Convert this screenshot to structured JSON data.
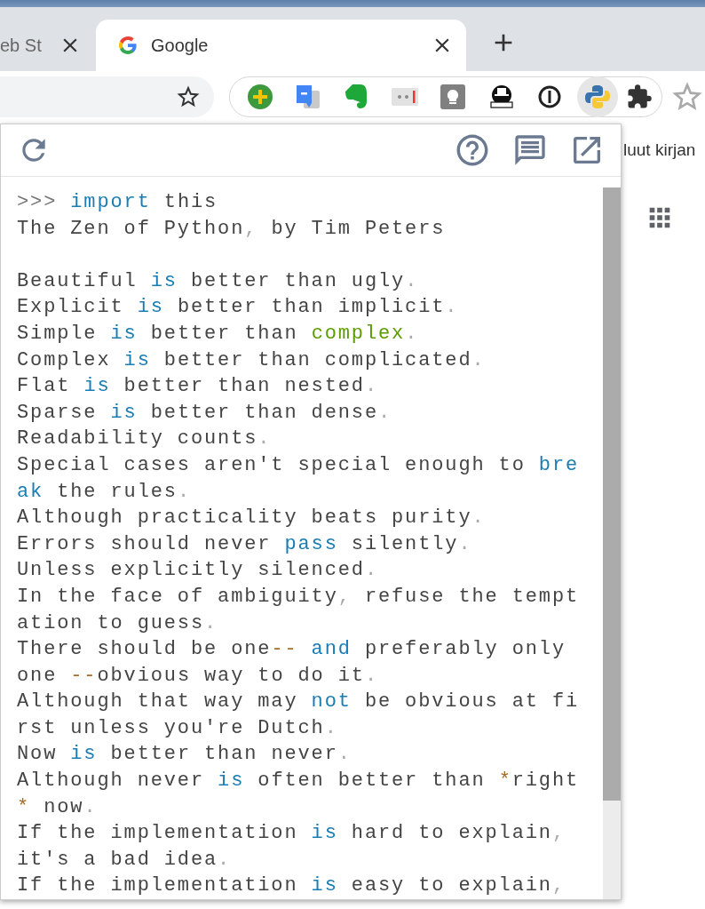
{
  "tabs": [
    {
      "title": "eb St",
      "selected": false
    },
    {
      "title": "Google",
      "selected": true
    }
  ],
  "page": {
    "bookmark_text": "luut kirjan"
  },
  "console": {
    "lines": [
      {
        "kind": "code",
        "segments": [
          {
            "text": ">>> ",
            "kind": "prompt"
          },
          {
            "text": "import",
            "kind": "keyword"
          },
          {
            "text": " this",
            "kind": "text"
          }
        ]
      },
      {
        "kind": "code",
        "segments": [
          {
            "text": "The Zen of Python",
            "kind": "text"
          },
          {
            "text": ",",
            "kind": "punct"
          },
          {
            "text": " by Tim Peters",
            "kind": "text"
          }
        ]
      },
      {
        "kind": "spacer"
      },
      {
        "kind": "code",
        "segments": [
          {
            "text": "Beautiful ",
            "kind": "text"
          },
          {
            "text": "is",
            "kind": "keyword"
          },
          {
            "text": " better than ugly",
            "kind": "text"
          },
          {
            "text": ".",
            "kind": "punct"
          }
        ]
      },
      {
        "kind": "code",
        "segments": [
          {
            "text": "Explicit ",
            "kind": "text"
          },
          {
            "text": "is",
            "kind": "keyword"
          },
          {
            "text": " better than implicit",
            "kind": "text"
          },
          {
            "text": ".",
            "kind": "punct"
          }
        ]
      },
      {
        "kind": "code",
        "segments": [
          {
            "text": "Simple ",
            "kind": "text"
          },
          {
            "text": "is",
            "kind": "keyword"
          },
          {
            "text": " better than ",
            "kind": "text"
          },
          {
            "text": "complex",
            "kind": "builtin"
          },
          {
            "text": ".",
            "kind": "punct"
          }
        ]
      },
      {
        "kind": "code",
        "segments": [
          {
            "text": "Complex ",
            "kind": "text"
          },
          {
            "text": "is",
            "kind": "keyword"
          },
          {
            "text": " better than complicated",
            "kind": "text"
          },
          {
            "text": ".",
            "kind": "punct"
          }
        ]
      },
      {
        "kind": "code",
        "segments": [
          {
            "text": "Flat ",
            "kind": "text"
          },
          {
            "text": "is",
            "kind": "keyword"
          },
          {
            "text": " better than nested",
            "kind": "text"
          },
          {
            "text": ".",
            "kind": "punct"
          }
        ]
      },
      {
        "kind": "code",
        "segments": [
          {
            "text": "Sparse ",
            "kind": "text"
          },
          {
            "text": "is",
            "kind": "keyword"
          },
          {
            "text": " better than dense",
            "kind": "text"
          },
          {
            "text": ".",
            "kind": "punct"
          }
        ]
      },
      {
        "kind": "code",
        "segments": [
          {
            "text": "Readability counts",
            "kind": "text"
          },
          {
            "text": ".",
            "kind": "punct"
          }
        ]
      },
      {
        "kind": "code",
        "segments": [
          {
            "text": "Special cases aren't special enough to ",
            "kind": "text"
          },
          {
            "text": "bre",
            "kind": "keyword"
          }
        ]
      },
      {
        "kind": "code",
        "segments": [
          {
            "text": "ak",
            "kind": "keyword"
          },
          {
            "text": " the rules",
            "kind": "text"
          },
          {
            "text": ".",
            "kind": "punct"
          }
        ]
      },
      {
        "kind": "code",
        "segments": [
          {
            "text": "Although practicality beats purity",
            "kind": "text"
          },
          {
            "text": ".",
            "kind": "punct"
          }
        ]
      },
      {
        "kind": "code",
        "segments": [
          {
            "text": "Errors should never ",
            "kind": "text"
          },
          {
            "text": "pass",
            "kind": "keyword"
          },
          {
            "text": " silently",
            "kind": "text"
          },
          {
            "text": ".",
            "kind": "punct"
          }
        ]
      },
      {
        "kind": "code",
        "segments": [
          {
            "text": "Unless explicitly silenced",
            "kind": "text"
          },
          {
            "text": ".",
            "kind": "punct"
          }
        ]
      },
      {
        "kind": "code",
        "segments": [
          {
            "text": "In the face of ambiguity",
            "kind": "text"
          },
          {
            "text": ",",
            "kind": "punct"
          },
          {
            "text": " refuse the tempt",
            "kind": "text"
          }
        ]
      },
      {
        "kind": "code",
        "segments": [
          {
            "text": "ation to guess",
            "kind": "text"
          },
          {
            "text": ".",
            "kind": "punct"
          }
        ]
      },
      {
        "kind": "code",
        "segments": [
          {
            "text": "There should be one",
            "kind": "text"
          },
          {
            "text": "-- ",
            "kind": "operator"
          },
          {
            "text": "and",
            "kind": "keyword"
          },
          {
            "text": " preferably only",
            "kind": "text"
          }
        ]
      },
      {
        "kind": "code",
        "segments": [
          {
            "text": "one ",
            "kind": "text"
          },
          {
            "text": "--",
            "kind": "operator"
          },
          {
            "text": "obvious way to do it",
            "kind": "text"
          },
          {
            "text": ".",
            "kind": "punct"
          }
        ]
      },
      {
        "kind": "code",
        "segments": [
          {
            "text": "Although that way may ",
            "kind": "text"
          },
          {
            "text": "not",
            "kind": "keyword"
          },
          {
            "text": " be obvious at fi",
            "kind": "text"
          }
        ]
      },
      {
        "kind": "code",
        "segments": [
          {
            "text": "rst unless you're Dutch",
            "kind": "text"
          },
          {
            "text": ".",
            "kind": "punct"
          }
        ]
      },
      {
        "kind": "code",
        "segments": [
          {
            "text": "Now ",
            "kind": "text"
          },
          {
            "text": "is",
            "kind": "keyword"
          },
          {
            "text": " better than never",
            "kind": "text"
          },
          {
            "text": ".",
            "kind": "punct"
          }
        ]
      },
      {
        "kind": "code",
        "segments": [
          {
            "text": "Although never ",
            "kind": "text"
          },
          {
            "text": "is",
            "kind": "keyword"
          },
          {
            "text": " often better than ",
            "kind": "text"
          },
          {
            "text": "*",
            "kind": "operator"
          },
          {
            "text": "right",
            "kind": "text"
          }
        ]
      },
      {
        "kind": "code",
        "segments": [
          {
            "text": "*",
            "kind": "operator"
          },
          {
            "text": " now",
            "kind": "text"
          },
          {
            "text": ".",
            "kind": "punct"
          }
        ]
      },
      {
        "kind": "code",
        "segments": [
          {
            "text": "If the implementation ",
            "kind": "text"
          },
          {
            "text": "is",
            "kind": "keyword"
          },
          {
            "text": " hard to explain",
            "kind": "text"
          },
          {
            "text": ",",
            "kind": "punct"
          }
        ]
      },
      {
        "kind": "code",
        "segments": [
          {
            "text": "it's a bad idea",
            "kind": "text"
          },
          {
            "text": ".",
            "kind": "punct"
          }
        ]
      },
      {
        "kind": "code",
        "segments": [
          {
            "text": "If the implementation ",
            "kind": "text"
          },
          {
            "text": "is",
            "kind": "keyword"
          },
          {
            "text": " easy to explain",
            "kind": "text"
          },
          {
            "text": ",",
            "kind": "punct"
          }
        ]
      }
    ]
  }
}
